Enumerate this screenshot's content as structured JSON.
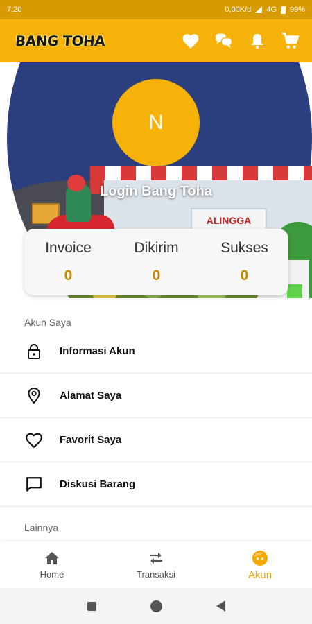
{
  "status_bar": {
    "time": "7:20",
    "speed": "0,00K/d",
    "network": "4G",
    "battery": "99%"
  },
  "app_bar": {
    "logo_text": "BANG TOHA",
    "icons": [
      "heart-icon",
      "chat-icon",
      "bell-icon",
      "cart-icon"
    ]
  },
  "hero": {
    "store_sign": "ALINGGA"
  },
  "profile": {
    "avatar_initial": "N",
    "title": "Login Bang Toha"
  },
  "stats": [
    {
      "label": "Invoice",
      "value": "0"
    },
    {
      "label": "Dikirim",
      "value": "0"
    },
    {
      "label": "Sukses",
      "value": "0"
    }
  ],
  "sections": {
    "account_title": "Akun Saya",
    "other_title": "Lainnya"
  },
  "menu": [
    {
      "label": "Informasi Akun",
      "icon": "lock-icon"
    },
    {
      "label": "Alamat Saya",
      "icon": "location-pin-icon"
    },
    {
      "label": "Favorit Saya",
      "icon": "heart-outline-icon"
    },
    {
      "label": "Diskusi Barang",
      "icon": "message-icon"
    }
  ],
  "bottom_nav": [
    {
      "label": "Home",
      "icon": "home-icon",
      "active": false
    },
    {
      "label": "Transaksi",
      "icon": "swap-icon",
      "active": false
    },
    {
      "label": "Akun",
      "icon": "face-icon",
      "active": true
    }
  ],
  "colors": {
    "primary": "#f7b20a",
    "status_bar": "#d79a00",
    "accent_text": "#c48a00",
    "active_nav": "#f5a800",
    "hero_bg": "#2b3f7e"
  }
}
